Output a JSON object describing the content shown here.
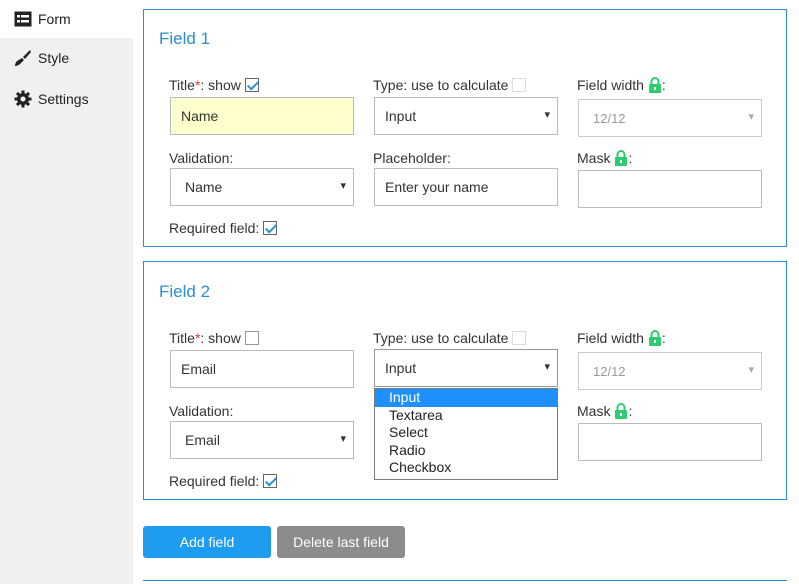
{
  "sidebar": {
    "items": [
      {
        "label": "Form",
        "icon": "form-icon"
      },
      {
        "label": "Style",
        "icon": "brush-icon"
      },
      {
        "label": "Settings",
        "icon": "gear-icon"
      }
    ]
  },
  "fields": [
    {
      "title": "Field 1",
      "title_label": "Title",
      "title_star": "*",
      "show_label": ": show",
      "show_checked": true,
      "title_value": "Name",
      "type_label": "Type: use to calculate",
      "type_value": "Input",
      "width_label": "Field width",
      "width_value": "12/12",
      "validation_label": "Validation:",
      "validation_value": "Name",
      "placeholder_label": "Placeholder:",
      "placeholder_value": "Enter your name",
      "mask_label": "Mask",
      "mask_value": "",
      "required_label": "Required field:",
      "required_checked": true
    },
    {
      "title": "Field 2",
      "title_label": "Title",
      "title_star": "*",
      "show_label": ": show",
      "show_checked": false,
      "title_value": "Email",
      "type_label": "Type: use to calculate",
      "type_value": "Input",
      "type_options": [
        "Input",
        "Textarea",
        "Select",
        "Radio",
        "Checkbox"
      ],
      "width_label": "Field width",
      "width_value": "12/12",
      "validation_label": "Validation:",
      "validation_value": "Email",
      "mask_label": "Mask",
      "mask_value": "",
      "required_label": "Required field:",
      "required_checked": true
    }
  ],
  "colon": ":",
  "buttons": {
    "add": "Add field",
    "delete": "Delete last field"
  },
  "colors": {
    "accent": "#2a8fd0",
    "lock": "#2ecc71",
    "highlight": "#1e90ff"
  }
}
